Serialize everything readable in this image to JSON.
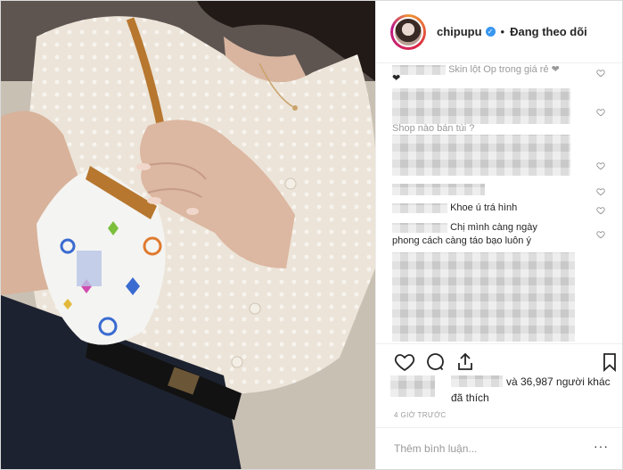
{
  "post": {
    "username": "chipupu",
    "verified_glyph": "✓",
    "separator": "•",
    "follow_status": "Đang theo dõi"
  },
  "comments": [
    {
      "visible_text": "Skin lột Op trong giá rẻ ❤",
      "liked_icon": "heart-outline-icon"
    },
    {
      "visible_text": "❤",
      "liked_icon": "heart-outline-icon"
    },
    {
      "visible_text": "",
      "liked_icon": "heart-outline-icon"
    },
    {
      "visible_text": "Shop nào bán túi ?",
      "liked_icon": ""
    },
    {
      "visible_text": "",
      "liked_icon": "heart-outline-icon"
    },
    {
      "visible_text": "Khoe      ú trá hình",
      "liked_icon": "heart-outline-icon"
    },
    {
      "visible_text": "Chị mình càng ngày",
      "liked_icon": "heart-outline-icon"
    },
    {
      "visible_text": "phong cách càng táo bạo luôn ý",
      "liked_icon": ""
    }
  ],
  "actions": {
    "like_icon": "heart-outline-icon",
    "comment_icon": "comment-icon",
    "share_icon": "share-icon",
    "save_icon": "bookmark-icon"
  },
  "likes": {
    "line1": "và 36,987 người khác",
    "line2": "đã thích"
  },
  "timestamp": "4 GIỜ TRƯỚC",
  "add_comment": {
    "placeholder": "Thêm bình luận...",
    "more_glyph": "···"
  },
  "colors": {
    "verified_blue": "#3897f0",
    "text_primary": "#262626",
    "text_muted": "#999999",
    "divider": "#efefef"
  }
}
